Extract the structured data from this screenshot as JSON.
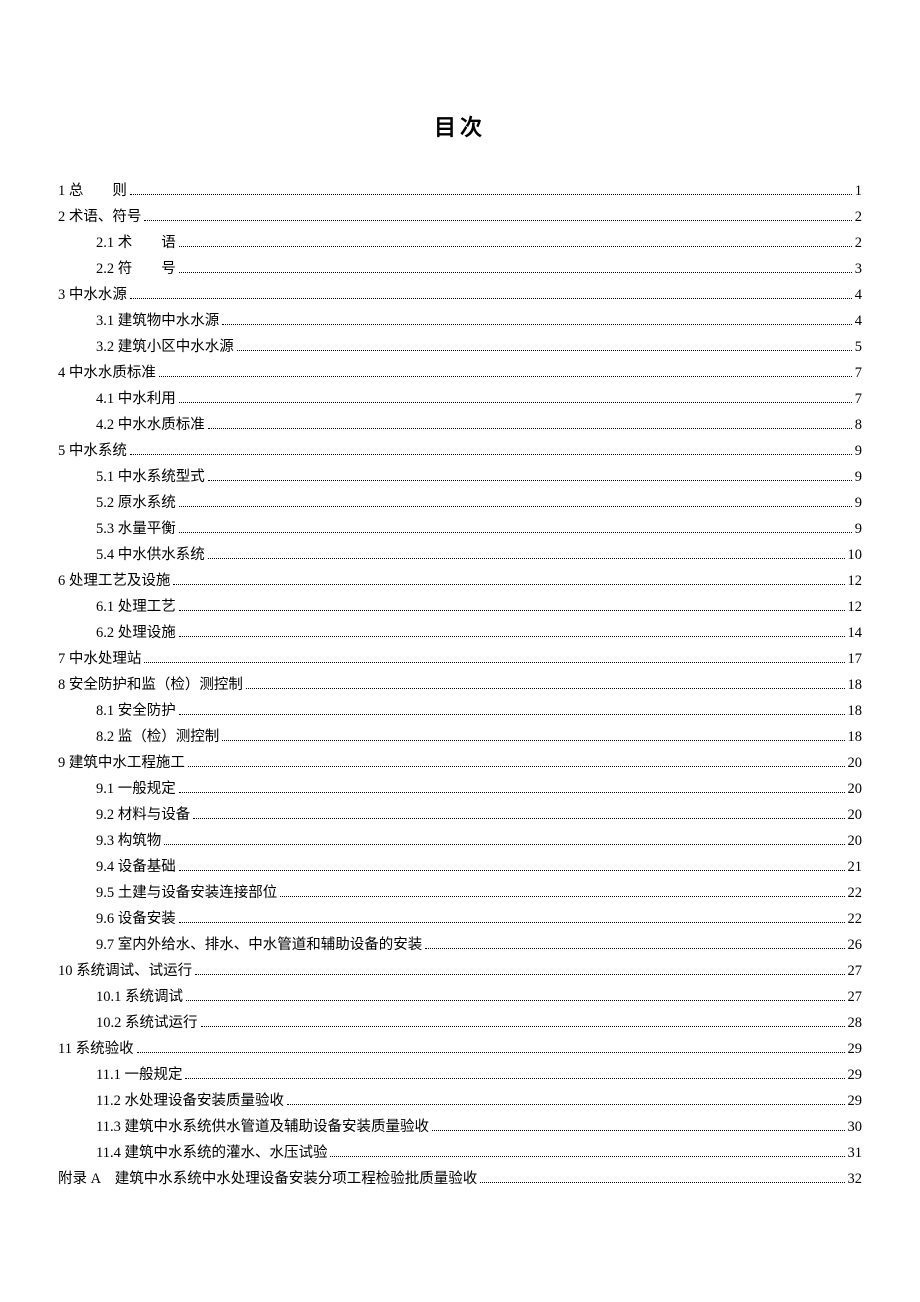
{
  "title": "目次",
  "entries": [
    {
      "level": 0,
      "label": "1  总　　则",
      "page": "1"
    },
    {
      "level": 0,
      "label": "2  术语、符号",
      "page": "2"
    },
    {
      "level": 1,
      "label": "2.1  术　　语",
      "page": "2"
    },
    {
      "level": 1,
      "label": "2.2  符　　号",
      "page": "3"
    },
    {
      "level": 0,
      "label": "3  中水水源",
      "page": "4"
    },
    {
      "level": 1,
      "label": "3.1  建筑物中水水源",
      "page": "4"
    },
    {
      "level": 1,
      "label": "3.2  建筑小区中水水源",
      "page": "5"
    },
    {
      "level": 0,
      "label": "4  中水水质标准",
      "page": "7"
    },
    {
      "level": 1,
      "label": "4.1  中水利用",
      "page": "7"
    },
    {
      "level": 1,
      "label": "4.2  中水水质标准",
      "page": "8"
    },
    {
      "level": 0,
      "label": "5  中水系统",
      "page": "9"
    },
    {
      "level": 1,
      "label": "5.1  中水系统型式",
      "page": "9"
    },
    {
      "level": 1,
      "label": "5.2  原水系统",
      "page": "9"
    },
    {
      "level": 1,
      "label": "5.3  水量平衡",
      "page": "9"
    },
    {
      "level": 1,
      "label": "5.4  中水供水系统",
      "page": "10"
    },
    {
      "level": 0,
      "label": "6  处理工艺及设施",
      "page": "12"
    },
    {
      "level": 1,
      "label": "6.1  处理工艺",
      "page": "12"
    },
    {
      "level": 1,
      "label": "6.2  处理设施",
      "page": "14"
    },
    {
      "level": 0,
      "label": "7  中水处理站",
      "page": "17"
    },
    {
      "level": 0,
      "label": "8  安全防护和监（检）测控制",
      "page": "18"
    },
    {
      "level": 1,
      "label": "8.1  安全防护",
      "page": "18"
    },
    {
      "level": 1,
      "label": "8.2  监（检）测控制",
      "page": "18"
    },
    {
      "level": 0,
      "label": "9  建筑中水工程施工",
      "page": "20"
    },
    {
      "level": 1,
      "label": "9.1  一般规定",
      "page": "20"
    },
    {
      "level": 1,
      "label": "9.2  材料与设备",
      "page": "20"
    },
    {
      "level": 1,
      "label": "9.3  构筑物",
      "page": "20"
    },
    {
      "level": 1,
      "label": "9.4  设备基础",
      "page": "21"
    },
    {
      "level": 1,
      "label": "9.5  土建与设备安装连接部位",
      "page": "22"
    },
    {
      "level": 1,
      "label": "9.6  设备安装",
      "page": "22"
    },
    {
      "level": 1,
      "label": "9.7  室内外给水、排水、中水管道和辅助设备的安装",
      "page": "26"
    },
    {
      "level": 0,
      "label": "10  系统调试、试运行",
      "page": "27"
    },
    {
      "level": 1,
      "label": "10.1  系统调试",
      "page": "27"
    },
    {
      "level": 1,
      "label": "10.2  系统试运行",
      "page": "28"
    },
    {
      "level": 0,
      "label": "11  系统验收",
      "page": "29"
    },
    {
      "level": 1,
      "label": "11.1  一般规定",
      "page": "29"
    },
    {
      "level": 1,
      "label": "11.2 水处理设备安装质量验收",
      "page": "29"
    },
    {
      "level": 1,
      "label": "11.3  建筑中水系统供水管道及辅助设备安装质量验收",
      "page": "30"
    },
    {
      "level": 1,
      "label": "11.4  建筑中水系统的灌水、水压试验",
      "page": "31"
    },
    {
      "level": 0,
      "label": "附录 A　建筑中水系统中水处理设备安装分项工程检验批质量验收",
      "page": "32"
    }
  ]
}
